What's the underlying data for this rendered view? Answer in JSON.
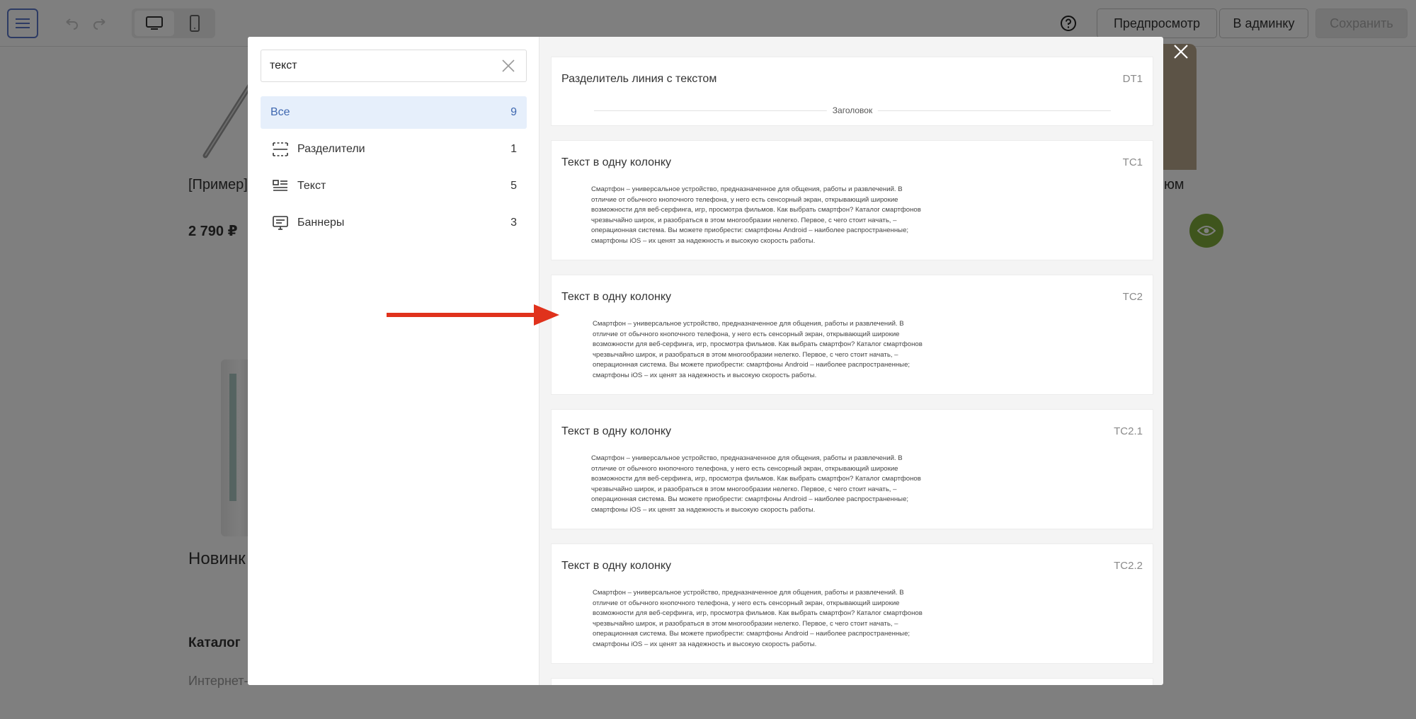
{
  "toolbar": {
    "preview_label": "Предпросмотр",
    "admin_label": "В админку",
    "save_label": "Сохранить"
  },
  "background": {
    "product1_name": "[Пример]",
    "product1_price": "2 790 ₽",
    "product2_name_fragment": "юм",
    "section_new": "Новинк",
    "section_catalog": "Каталог",
    "footer_fragment": "Интернет-"
  },
  "search": {
    "value": "текст",
    "placeholder": ""
  },
  "categories": [
    {
      "label": "Все",
      "count": "9",
      "icon": "all"
    },
    {
      "label": "Разделители",
      "count": "1",
      "icon": "divider-icon"
    },
    {
      "label": "Текст",
      "count": "5",
      "icon": "text-icon"
    },
    {
      "label": "Баннеры",
      "count": "3",
      "icon": "banner-icon"
    }
  ],
  "blocks": [
    {
      "title": "Разделитель линия с текстом",
      "code": "DT1",
      "preview_label": "Заголовок"
    },
    {
      "title": "Текст в одну колонку",
      "code": "TC1",
      "lines": [
        "Смартфон – универсальное устройство, предназначенное для общения, работы и развлечений. В",
        "отличие от обычного кнопочного телефона, у него есть сенсорный экран, открывающий широкие",
        "возможности для веб-серфинга, игр, просмотра фильмов. Как выбрать смартфон? Каталог смартфонов",
        "чрезвычайно широк, и разобраться в этом многообразии нелегко. Первое, с чего стоит начать, –",
        "операционная система. Вы можете приобрести: смартфоны Android – наиболее распространенные;",
        "смартфоны iOS – их ценят за надежность и высокую скорость работы."
      ]
    },
    {
      "title": "Текст в одну колонку",
      "code": "TC2",
      "lines": [
        "Смартфон – универсальное устройство, предназначенное для общения, работы и развлечений. В",
        "отличие от обычного кнопочного телефона, у него есть сенсорный экран, открывающий широкие",
        "возможности для веб-серфинга, игр, просмотра фильмов. Как выбрать смартфон? Каталог смартфонов",
        "чрезвычайно широк, и разобраться в этом многообразии нелегко. Первое, с чего стоит начать, –",
        "операционная система. Вы можете приобрести: смартфоны Android – наиболее распространенные;",
        "смартфоны iOS – их ценят за надежность и высокую скорость работы."
      ]
    },
    {
      "title": "Текст в одну колонку",
      "code": "TC2.1",
      "lines": [
        "Смартфон – универсальное устройство, предназначенное для общения, работы и развлечений. В",
        "отличие от обычного кнопочного телефона, у него есть сенсорный экран, открывающий широкие",
        "возможности для веб-серфинга, игр, просмотра фильмов. Как выбрать смартфон? Каталог смартфонов",
        "чрезвычайно широк, и разобраться в этом многообразии нелегко. Первое, с чего стоит начать, –",
        "операционная система. Вы можете приобрести: смартфоны Android – наиболее распространенные;",
        "смартфоны iOS – их ценят за надежность и высокую скорость работы."
      ]
    },
    {
      "title": "Текст в одну колонку",
      "code": "TC2.2",
      "lines": [
        "Смартфон – универсальное устройство, предназначенное для общения, работы и развлечений. В",
        "отличие от обычного кнопочного телефона, у него есть сенсорный экран, открывающий широкие",
        "возможности для веб-серфинга, игр, просмотра фильмов. Как выбрать смартфон? Каталог смартфонов",
        "чрезвычайно широк, и разобраться в этом многообразии нелегко. Первое, с чего стоит начать, –",
        "операционная система. Вы можете приобрести: смартфоны Android – наиболее распространенные;",
        "смартфоны iOS – их ценят за надежность и высокую скорость работы."
      ]
    }
  ],
  "colors": {
    "accent": "#3f68b0",
    "active_bg": "#e6effb",
    "arrow": "#e0321c",
    "eye_button": "#7faa3b"
  }
}
